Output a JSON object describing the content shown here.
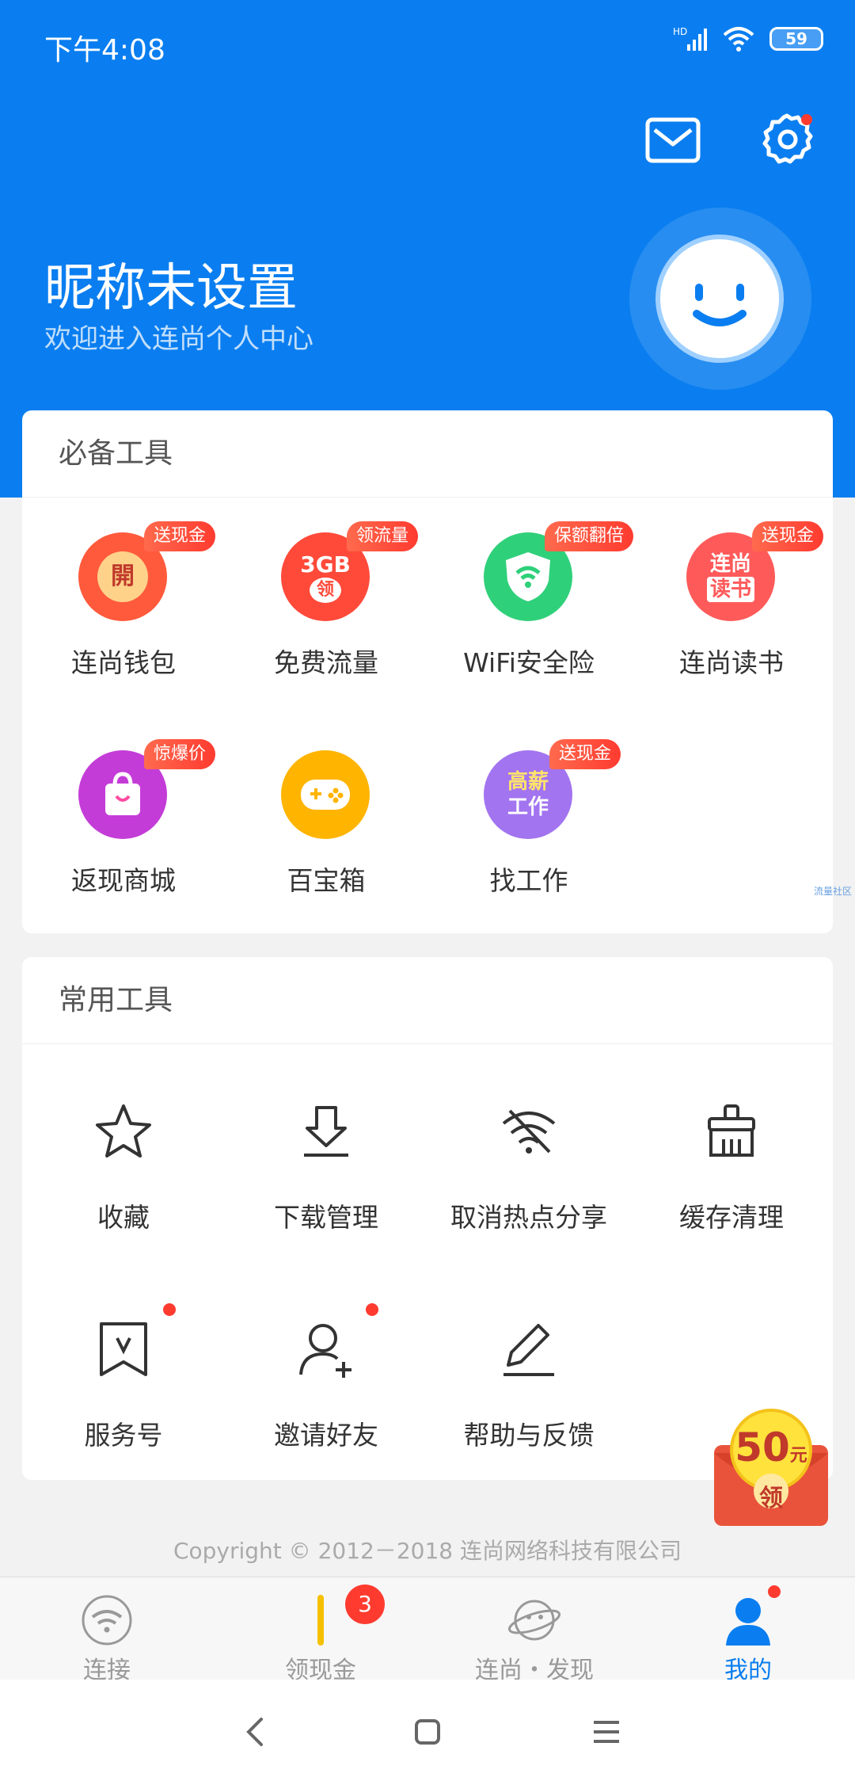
{
  "status": {
    "time": "下午4:08",
    "network": "HD",
    "battery": "59"
  },
  "profile": {
    "nickname": "昵称未设置",
    "welcome": "欢迎进入连尚个人中心"
  },
  "essential_tools": {
    "title": "必备工具",
    "items": [
      {
        "label": "连尚钱包",
        "badge": "送现金",
        "glyph": "開",
        "color": "#ff5a3c"
      },
      {
        "label": "免费流量",
        "badge": "领流量",
        "glyph": "3GB",
        "glyph2": "领",
        "color": "#ff4a3a"
      },
      {
        "label": "WiFi安全险",
        "badge": "保额翻倍",
        "color": "#2fd07a"
      },
      {
        "label": "连尚读书",
        "badge": "送现金",
        "glyph": "连尚",
        "glyph2": "读书",
        "color": "#ff5a5a"
      },
      {
        "label": "返现商城",
        "badge": "惊爆价",
        "color": "#c43cd8"
      },
      {
        "label": "百宝箱",
        "color": "#ffb400"
      },
      {
        "label": "找工作",
        "badge": "送现金",
        "glyph": "高薪",
        "glyph2": "工作",
        "color": "#a274f0"
      }
    ]
  },
  "common_tools": {
    "title": "常用工具",
    "items": [
      {
        "label": "收藏"
      },
      {
        "label": "下载管理"
      },
      {
        "label": "取消热点分享"
      },
      {
        "label": "缓存清理"
      },
      {
        "label": "服务号"
      },
      {
        "label": "邀请好友"
      },
      {
        "label": "帮助与反馈"
      }
    ]
  },
  "side_hint": "流量社区",
  "copyright": "Copyright © 2012－2018 连尚网络科技有限公司",
  "redpacket": {
    "amount": "50",
    "unit": "元",
    "action": "领"
  },
  "tabs": [
    {
      "label": "连接"
    },
    {
      "label": "领现金",
      "badge": "3"
    },
    {
      "label": "连尚・发现"
    },
    {
      "label": "我的"
    }
  ],
  "colors": {
    "primary": "#0a7ef0",
    "badge": "#ff3b30"
  }
}
